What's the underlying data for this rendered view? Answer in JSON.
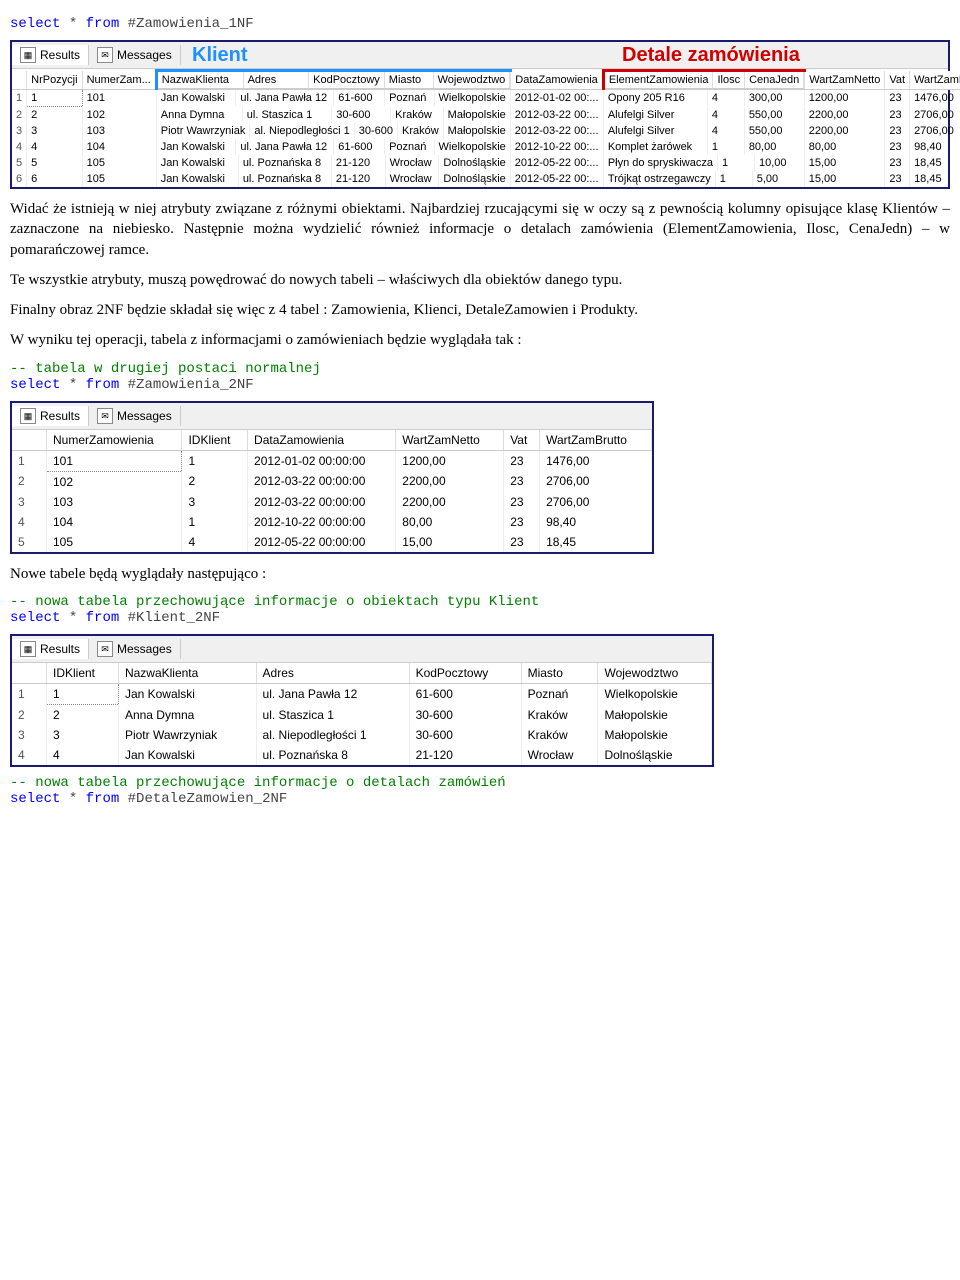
{
  "sql1": {
    "kw1": "select",
    "star": "*",
    "kw2": "from",
    "tbl": "#Zamowienia_1NF"
  },
  "grid1": {
    "tabs": {
      "results": "Results",
      "messages": "Messages"
    },
    "labelKlient": "Klient",
    "labelDetale": "Detale zamówienia",
    "cols": [
      "NrPozycji",
      "NumerZam...",
      "NazwaKlienta",
      "Adres",
      "KodPocztowy",
      "Miasto",
      "Wojewodztwo",
      "DataZamowienia",
      "ElementZamowienia",
      "Ilosc",
      "CenaJedn",
      "WartZamNetto",
      "Vat",
      "WartZamBrutto"
    ],
    "rows": [
      [
        "1",
        "1",
        "101",
        "Jan Kowalski",
        "ul. Jana Pawła 12",
        "61-600",
        "Poznań",
        "Wielkopolskie",
        "2012-01-02 00:...",
        "Opony 205 R16",
        "4",
        "300,00",
        "1200,00",
        "23",
        "1476,00"
      ],
      [
        "2",
        "2",
        "102",
        "Anna Dymna",
        "ul. Staszica 1",
        "30-600",
        "Kraków",
        "Małopolskie",
        "2012-03-22 00:...",
        "Alufelgi Silver",
        "4",
        "550,00",
        "2200,00",
        "23",
        "2706,00"
      ],
      [
        "3",
        "3",
        "103",
        "Piotr Wawrzyniak",
        "al. Niepodległości 1",
        "30-600",
        "Kraków",
        "Małopolskie",
        "2012-03-22 00:...",
        "Alufelgi Silver",
        "4",
        "550,00",
        "2200,00",
        "23",
        "2706,00"
      ],
      [
        "4",
        "4",
        "104",
        "Jan Kowalski",
        "ul. Jana Pawła 12",
        "61-600",
        "Poznań",
        "Wielkopolskie",
        "2012-10-22 00:...",
        "Komplet żarówek",
        "1",
        "80,00",
        "80,00",
        "23",
        "98,40"
      ],
      [
        "5",
        "5",
        "105",
        "Jan Kowalski",
        "ul. Poznańska 8",
        "21-120",
        "Wrocław",
        "Dolnośląskie",
        "2012-05-22 00:...",
        "Płyn do spryskiwacza",
        "1",
        "10,00",
        "15,00",
        "23",
        "18,45"
      ],
      [
        "6",
        "6",
        "105",
        "Jan Kowalski",
        "ul. Poznańska 8",
        "21-120",
        "Wrocław",
        "Dolnośląskie",
        "2012-05-22 00:...",
        "Trójkąt ostrzegawczy",
        "1",
        "5,00",
        "15,00",
        "23",
        "18,45"
      ]
    ]
  },
  "para1": "Widać że istnieją w niej atrybuty związane z różnymi obiektami. Najbardziej rzucającymi się w oczy są z pewnością kolumny opisujące klasę Klientów – zaznaczone na niebiesko. Następnie można wydzielić również informacje o detalach zamówienia (ElementZamowienia, Ilosc, CenaJedn) – w pomarańczowej ramce.",
  "para2": "Te wszystkie atrybuty, muszą powędrować do nowych tabeli – właściwych dla obiektów danego typu.",
  "para3": "Finalny obraz 2NF będzie składał się więc z 4 tabel : Zamowienia, Klienci, DetaleZamowien i Produkty.",
  "para4": "W wyniku tej operacji, tabela z informacjami o zamówieniach będzie wyglądała tak :",
  "sql2": {
    "cmt": "-- tabela w drugiej postaci normalnej",
    "kw1": "select",
    "star": "*",
    "kw2": "from",
    "tbl": "#Zamowienia_2NF"
  },
  "grid2": {
    "tabs": {
      "results": "Results",
      "messages": "Messages"
    },
    "cols": [
      "NumerZamowienia",
      "IDKlient",
      "DataZamowienia",
      "WartZamNetto",
      "Vat",
      "WartZamBrutto"
    ],
    "rows": [
      [
        "1",
        "101",
        "1",
        "2012-01-02 00:00:00",
        "1200,00",
        "23",
        "1476,00"
      ],
      [
        "2",
        "102",
        "2",
        "2012-03-22 00:00:00",
        "2200,00",
        "23",
        "2706,00"
      ],
      [
        "3",
        "103",
        "3",
        "2012-03-22 00:00:00",
        "2200,00",
        "23",
        "2706,00"
      ],
      [
        "4",
        "104",
        "1",
        "2012-10-22 00:00:00",
        "80,00",
        "23",
        "98,40"
      ],
      [
        "5",
        "105",
        "4",
        "2012-05-22 00:00:00",
        "15,00",
        "23",
        "18,45"
      ]
    ]
  },
  "para5": "Nowe tabele będą wyglądały następująco :",
  "sql3": {
    "cmt": "-- nowa tabela przechowujące informacje o obiektach typu Klient",
    "kw1": "select",
    "star": "*",
    "kw2": "from",
    "tbl": "#Klient_2NF"
  },
  "grid3": {
    "tabs": {
      "results": "Results",
      "messages": "Messages"
    },
    "cols": [
      "IDKlient",
      "NazwaKlienta",
      "Adres",
      "KodPocztowy",
      "Miasto",
      "Wojewodztwo"
    ],
    "rows": [
      [
        "1",
        "1",
        "Jan Kowalski",
        "ul. Jana Pawła 12",
        "61-600",
        "Poznań",
        "Wielkopolskie"
      ],
      [
        "2",
        "2",
        "Anna Dymna",
        "ul. Staszica 1",
        "30-600",
        "Kraków",
        "Małopolskie"
      ],
      [
        "3",
        "3",
        "Piotr Wawrzyniak",
        "al. Niepodległości 1",
        "30-600",
        "Kraków",
        "Małopolskie"
      ],
      [
        "4",
        "4",
        "Jan Kowalski",
        "ul. Poznańska 8",
        "21-120",
        "Wrocław",
        "Dolnośląskie"
      ]
    ]
  },
  "sql4": {
    "cmt": "-- nowa tabela przechowujące informacje o detalach zamówień",
    "kw1": "select",
    "star": "*",
    "kw2": "from",
    "tbl": "#DetaleZamowien_2NF"
  }
}
